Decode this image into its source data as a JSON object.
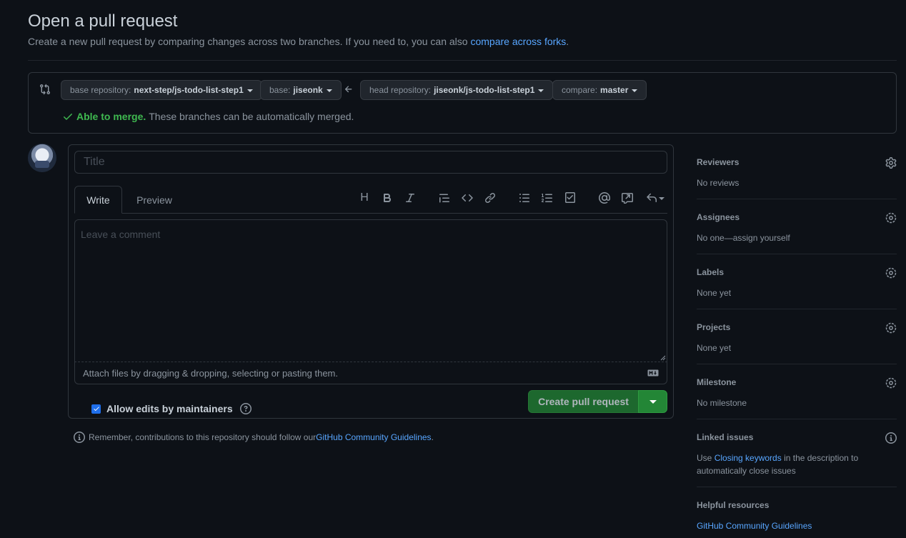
{
  "page": {
    "title": "Open a pull request",
    "subtitle_prefix": "Create a new pull request by comparing changes across two branches. If you need to, you can also ",
    "subtitle_link": "compare across forks",
    "subtitle_suffix": "."
  },
  "range": {
    "base_repo_label": "base repository:",
    "base_repo_value": "next-step/js-todo-list-step1",
    "base_label": "base:",
    "base_value": "jiseonk",
    "head_repo_label": "head repository:",
    "head_repo_value": "jiseonk/js-todo-list-step1",
    "compare_label": "compare:",
    "compare_value": "master",
    "merge_ok": "Able to merge.",
    "merge_text": "These branches can be automatically merged."
  },
  "form": {
    "title_placeholder": "Title",
    "tabs": {
      "write": "Write",
      "preview": "Preview"
    },
    "comment_placeholder": "Leave a comment",
    "attach_text": "Attach files by dragging & dropping, selecting or pasting them.",
    "allow_edits": "Allow edits by maintainers",
    "allow_edits_checked": true,
    "create_button": "Create pull request",
    "remember_prefix": "Remember, contributions to this repository should follow our ",
    "remember_link": "GitHub Community Guidelines",
    "remember_suffix": "."
  },
  "toolbar": {
    "heading": "H",
    "icons": [
      "heading-icon",
      "bold-icon",
      "italic-icon",
      "quote-icon",
      "code-icon",
      "link-icon",
      "unordered-list-icon",
      "ordered-list-icon",
      "task-list-icon",
      "mention-icon",
      "reference-icon",
      "reply-icon"
    ]
  },
  "sidebar": {
    "reviewers": {
      "title": "Reviewers",
      "value": "No reviews"
    },
    "assignees": {
      "title": "Assignees",
      "value": "No one—assign yourself"
    },
    "labels": {
      "title": "Labels",
      "value": "None yet"
    },
    "projects": {
      "title": "Projects",
      "value": "None yet"
    },
    "milestone": {
      "title": "Milestone",
      "value": "No milestone"
    },
    "linked_issues": {
      "title": "Linked issues",
      "value_prefix": "Use ",
      "value_link": "Closing keywords",
      "value_suffix": " in the description to automatically close issues"
    },
    "helpful": {
      "title": "Helpful resources",
      "link": "GitHub Community Guidelines"
    }
  },
  "colors": {
    "background": "#0d1117",
    "border": "#30363d",
    "link": "#58a6ff",
    "success": "#3fb950",
    "primary_button": "#238636"
  }
}
